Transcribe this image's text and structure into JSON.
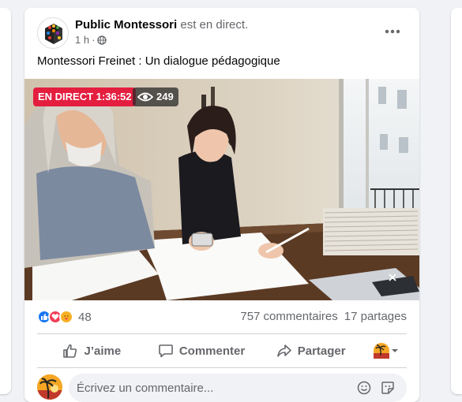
{
  "post": {
    "author": "Public Montessori",
    "status": "est en direct.",
    "time": "1 h",
    "separator": "·",
    "visibility_icon": "globe-icon",
    "text": "Montessori Freinet : Un dialogue pédagogique"
  },
  "video": {
    "live_label": "EN DIRECT 1:36:52",
    "viewer_count": "249"
  },
  "stats": {
    "reaction_icons": [
      "like-icon",
      "love-icon",
      "care-icon"
    ],
    "reaction_count": "48",
    "comments": "757 commentaires",
    "shares": "17 partages"
  },
  "actions": {
    "like": "J’aime",
    "comment": "Commenter",
    "share": "Partager"
  },
  "comment_box": {
    "placeholder": "Écrivez un commentaire..."
  },
  "colors": {
    "accent_blue": "#1877f2",
    "live_red": "#e41e3f",
    "secondary_text": "#65676b",
    "divider": "#ced0d4"
  }
}
